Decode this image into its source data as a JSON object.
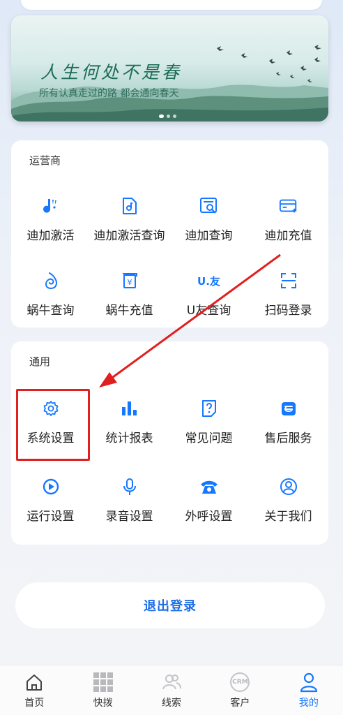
{
  "banner": {
    "title": "人生何处不是春",
    "subtitle": "所有认真走过的路 都会通向春天"
  },
  "operator_section": {
    "title": "运营商",
    "items": [
      {
        "label": "迪加激活",
        "icon": "dijia-activate-icon"
      },
      {
        "label": "迪加激活查询",
        "icon": "activation-query-icon"
      },
      {
        "label": "迪加查询",
        "icon": "search-doc-icon"
      },
      {
        "label": "迪加充值",
        "icon": "card-recharge-icon"
      },
      {
        "label": "蜗牛查询",
        "icon": "snail-icon"
      },
      {
        "label": "蜗牛充值",
        "icon": "yuan-recharge-icon"
      },
      {
        "label": "U友查询",
        "icon": "uyou-logo-icon"
      },
      {
        "label": "扫码登录",
        "icon": "scan-icon"
      }
    ],
    "uyou_logo": "U.友"
  },
  "general_section": {
    "title": "通用",
    "items": [
      {
        "label": "系统设置",
        "icon": "gear-icon"
      },
      {
        "label": "统计报表",
        "icon": "bar-chart-icon"
      },
      {
        "label": "常见问题",
        "icon": "question-doc-icon"
      },
      {
        "label": "售后服务",
        "icon": "service-icon"
      },
      {
        "label": "运行设置",
        "icon": "play-circle-icon"
      },
      {
        "label": "录音设置",
        "icon": "microphone-icon"
      },
      {
        "label": "外呼设置",
        "icon": "telephone-icon"
      },
      {
        "label": "关于我们",
        "icon": "user-circle-icon"
      }
    ]
  },
  "logout": {
    "label": "退出登录"
  },
  "tabbar": {
    "tabs": [
      {
        "label": "首页",
        "icon": "home-icon",
        "active": false
      },
      {
        "label": "快拨",
        "icon": "dialpad-grid-icon",
        "active": false
      },
      {
        "label": "线索",
        "icon": "users-icon",
        "active": false
      },
      {
        "label": "客户",
        "icon": "crm-icon",
        "active": false
      },
      {
        "label": "我的",
        "icon": "person-icon",
        "active": true
      }
    ],
    "crm_text": "CRM"
  },
  "colors": {
    "accent": "#1677ff",
    "highlight": "#e0201f",
    "banner_text": "#1d6d55"
  }
}
